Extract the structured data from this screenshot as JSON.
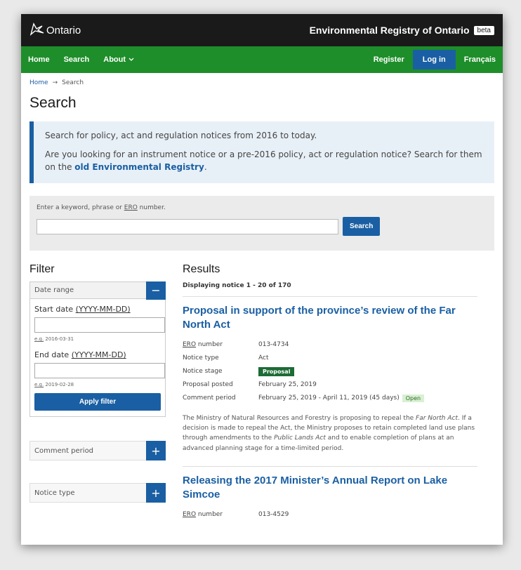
{
  "header": {
    "logo_text": "Ontario",
    "site_title": "Environmental Registry of Ontario",
    "beta_label": "beta"
  },
  "nav": {
    "home": "Home",
    "search": "Search",
    "about": "About",
    "register": "Register",
    "login": "Log in",
    "language": "Français"
  },
  "breadcrumb": {
    "home": "Home",
    "separator": "→",
    "current": "Search"
  },
  "page_title": "Search",
  "info": {
    "line1": "Search for policy, act and regulation notices from 2016 to today.",
    "line2_pre": "Are you looking for an instrument notice or a pre-2016 policy, act or regulation notice? Search for them on the ",
    "line2_link": "old Environmental Registry",
    "line2_post": "."
  },
  "search": {
    "label_pre": "Enter a keyword, phrase or ",
    "label_abbr": "ERO",
    "label_post": " number.",
    "value": "",
    "button": "Search"
  },
  "filter": {
    "heading": "Filter",
    "date_range": {
      "label": "Date range",
      "toggle": "−",
      "start_label": "Start date ",
      "start_format": "(YYYY-MM-DD)",
      "start_value": "",
      "start_hint_abbr": "e.g.",
      "start_hint": " 2016-03-31",
      "end_label": "End date ",
      "end_format": "(YYYY-MM-DD)",
      "end_value": "",
      "end_hint_abbr": "e.g.",
      "end_hint": " 2019-02-28",
      "apply": "Apply filter"
    },
    "comment_period": {
      "label": "Comment period",
      "toggle": "+"
    },
    "notice_type": {
      "label": "Notice type",
      "toggle": "+"
    }
  },
  "results": {
    "heading": "Results",
    "count": "Displaying notice 1 - 20 of 170",
    "notices": [
      {
        "title": "Proposal in support of the province’s review of the Far North Act",
        "ero_key_abbr": "ERO",
        "ero_key": " number",
        "ero_number": "013-4734",
        "type_key": "Notice type",
        "type": "Act",
        "stage_key": "Notice stage",
        "stage": "Proposal",
        "posted_key": "Proposal posted",
        "posted": "February 25, 2019",
        "comment_key": "Comment period",
        "comment": "February 25, 2019 - April 11, 2019 (45 days)",
        "status": "Open",
        "desc_1": "The Ministry of Natural Resources and Forestry is proposing to repeal the ",
        "desc_2": "Far North Act",
        "desc_3": ". If a decision is made to repeal the Act, the Ministry proposes to retain completed land use plans through amendments to the ",
        "desc_4": "Public Lands Act",
        "desc_5": " and to enable completion of plans at an advanced planning stage for a time-limited period."
      },
      {
        "title": "Releasing the 2017 Minister’s Annual Report on Lake Simcoe",
        "ero_key_abbr": "ERO",
        "ero_key": " number",
        "ero_number": "013-4529"
      }
    ]
  },
  "colors": {
    "topbar": "#1a1a1a",
    "navbar": "#1e8e2a",
    "primary": "#1a5fa3",
    "stage_badge": "#1d6b36",
    "open_badge": "#d9f0d3"
  },
  "icons": {
    "logo": "trillium-logo-icon",
    "about_dropdown": "chevron-down-icon",
    "collapse": "minus-icon",
    "expand": "plus-icon"
  }
}
